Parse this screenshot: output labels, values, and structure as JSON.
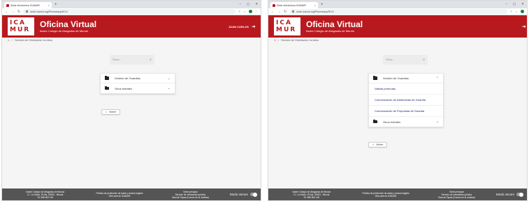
{
  "left": {
    "tab_title": "Sede electrónica ICAMUR",
    "url": "sede.icamur.org/Prisma/asp/SOJ/",
    "user_name": "JUAN CARLOS",
    "panel_rows": [
      {
        "label": "Gestión de Guardias",
        "chev": "⌄"
      },
      {
        "label": "Otros trámites",
        "chev": "⌄"
      }
    ]
  },
  "right": {
    "tab_title": "Sede electrónica ICAMUR",
    "url": "sede.icamur.org/Prisma/asp/SOJ/",
    "expanded_row": {
      "label": "Gestión de Guardias",
      "chev": "⌃"
    },
    "sub_items": [
      "Validar permutas",
      "Comunicación de Asistencias de Guardia",
      "Comunicación de Propuesta de Guardia"
    ],
    "collapsed_row": {
      "label": "Otros trámites",
      "chev": "⌄"
    }
  },
  "site": {
    "logo_line1": "ICA",
    "logo_line2": "MUR",
    "title": "Oficina Virtual",
    "subtitle": "Ilustre Colegio de Abogados de Murcia"
  },
  "breadcrumb": "Servicio de Orientación Jurídica",
  "search_placeholder": "Filtrar...",
  "back_label": "Volver",
  "footer": {
    "col1": [
      "Ilustre Colegio de Abogados de Murcia",
      "C/. La Gloria, 33 bis, 30003 - Murcia",
      "Tfl. 968 902 100"
    ],
    "col2": [
      "Política de protección de datos y avisos legales",
      "Otra web de ICAMUR"
    ],
    "col3": [
      "Sede principal",
      "Servicio de orientación jurídica",
      "Tasa de Tapas (Cursos de la Justicia)"
    ],
    "dark_mode": "Modo oscuro"
  },
  "colors": {
    "brand": "#b8191f",
    "footer": "#555555"
  }
}
